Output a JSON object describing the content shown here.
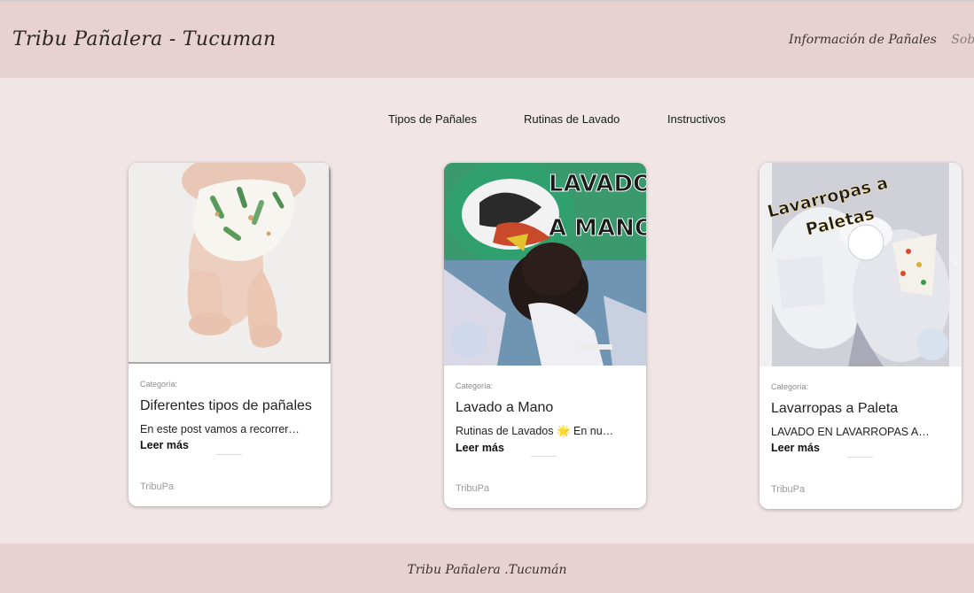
{
  "header": {
    "site_title": "Tribu Pañalera - Tucuman",
    "nav": [
      {
        "label": "Información de Pañales"
      },
      {
        "label": "Sobre N"
      }
    ]
  },
  "subnav": [
    {
      "label": "Tipos de Pañales"
    },
    {
      "label": "Rutinas de Lavado"
    },
    {
      "label": "Instructivos"
    }
  ],
  "cards": [
    {
      "category": "Categoría:",
      "title": "Diferentes tipos de pañales",
      "excerpt": "En este post vamos a recorrer…",
      "read_more": "Leer más",
      "author": "TribuPa",
      "image_alt": "baby-wearing-cloth-diaper-photo"
    },
    {
      "category": "Categoría:",
      "title": "Lavado a Mano",
      "excerpt": "Rutinas de Lavados 🌟 En nu…",
      "read_more": "Leer más",
      "author": "TribuPa",
      "image_caption_1": "LAVADO",
      "image_caption_2": "A MANO"
    },
    {
      "category": "Categoría:",
      "title": "Lavarropas a Paleta",
      "excerpt": "LAVADO EN LAVARROPAS A…",
      "read_more": "Leer más",
      "author": "TribuPa",
      "image_caption_1": "Lavarropas a",
      "image_caption_2": "Paletas"
    }
  ],
  "footer": {
    "text": "Tribu Pañalera .Tucumán"
  }
}
